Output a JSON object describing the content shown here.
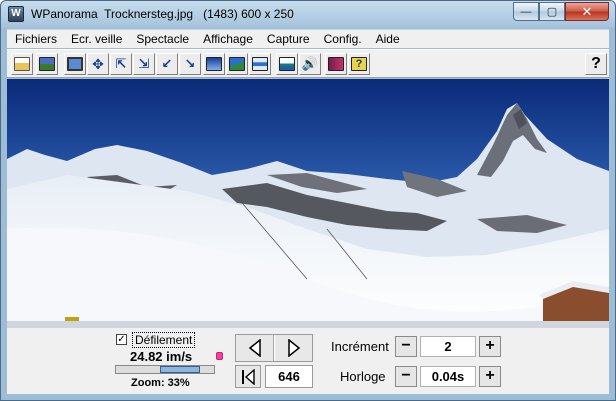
{
  "window": {
    "title": "WPanorama  Trocknersteg.jpg   (1483) 600 x 250",
    "minimize": "—",
    "maximize": "▢",
    "close": "✕"
  },
  "menu": [
    "Fichiers",
    "Ecr. veille",
    "Spectacle",
    "Affichage",
    "Capture",
    "Config.",
    "Aide"
  ],
  "toolbar": {
    "buttons": [
      "open-icon",
      "image-icon",
      "fit-icon",
      "move-icon",
      "shrink-icon",
      "expand-icon",
      "expand-left-icon",
      "corner-icon",
      "gradient-icon",
      "landscape-icon",
      "bar-icon",
      "sea-icon",
      "sound-icon",
      "book-icon",
      "help-book-icon"
    ],
    "help_label": "?"
  },
  "controls": {
    "scroll_label": "Défilement",
    "scroll_checked": "✓",
    "speed": "24.82 im/s",
    "zoom": "Zoom: 33%",
    "zoom_fraction": 0.33,
    "frame": "646",
    "increment_label": "Incrément",
    "increment_value": "2",
    "clock_label": "Horloge",
    "clock_value": "0.04s",
    "minus": "−",
    "plus": "+"
  },
  "colors": {
    "sky_top": "#0b2a7a",
    "sky_bottom": "#4a7fc4",
    "snow": "#f2f4f8"
  }
}
